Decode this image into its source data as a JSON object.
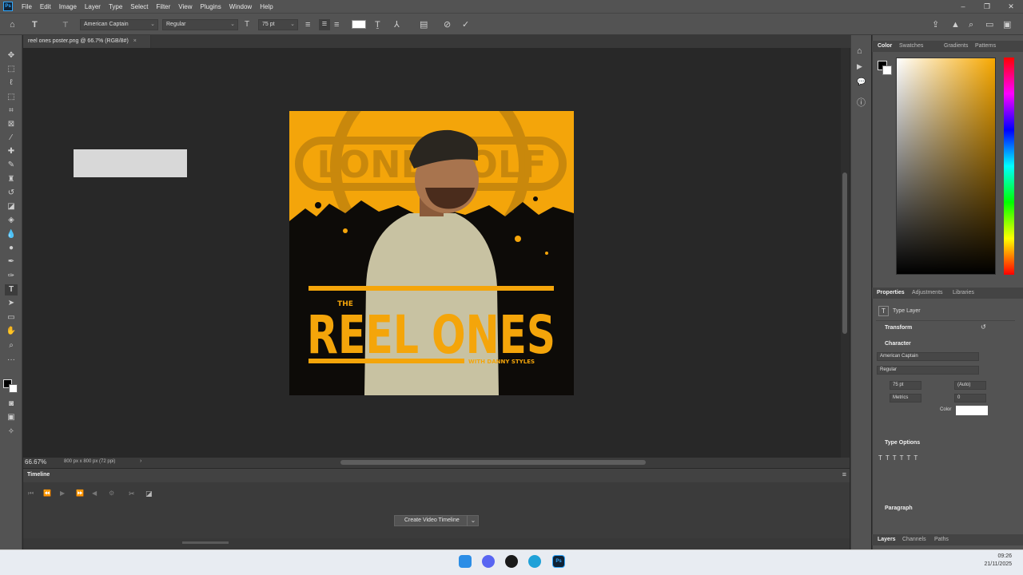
{
  "app": {
    "logo": "Ps",
    "menus": [
      "File",
      "Edit",
      "Image",
      "Layer",
      "Type",
      "Select",
      "Filter",
      "View",
      "Plugins",
      "Window",
      "Help"
    ]
  },
  "options": {
    "font_family": "American Captain",
    "font_style": "Regular",
    "font_size": "75 pt"
  },
  "document": {
    "tab_title": "reel ones poster.png @ 66.7% (RGB/8#)",
    "zoom": "66.67%",
    "size_info": "800 px x 800 px (72 ppi)"
  },
  "poster": {
    "bg_word": "LONEWOLF",
    "prefix": "THE",
    "title_left": "REEL",
    "title_right": "ONES",
    "byline": "WITH DANNY STYLES",
    "accent": "#f4a50a"
  },
  "timeline": {
    "title": "Timeline",
    "create_button": "Create Video Timeline"
  },
  "color_panel": {
    "tabs": [
      "Color",
      "Swatches",
      "Gradients",
      "Patterns"
    ]
  },
  "properties": {
    "tabs": [
      "Properties",
      "Adjustments",
      "Libraries"
    ],
    "layer_type": "Type Layer",
    "transform": "Transform",
    "character": "Character",
    "font_family": "American Captain",
    "font_style": "Regular",
    "size": "75 pt",
    "leading": "(Auto)",
    "kerning": "Metrics",
    "tracking": "0",
    "color_label": "Color",
    "type_options": "Type Options",
    "paragraph": "Paragraph"
  },
  "layers_tabs": [
    "Layers",
    "Channels",
    "Paths"
  ],
  "clock": {
    "time": "09:26",
    "date": "21/11/2025"
  }
}
